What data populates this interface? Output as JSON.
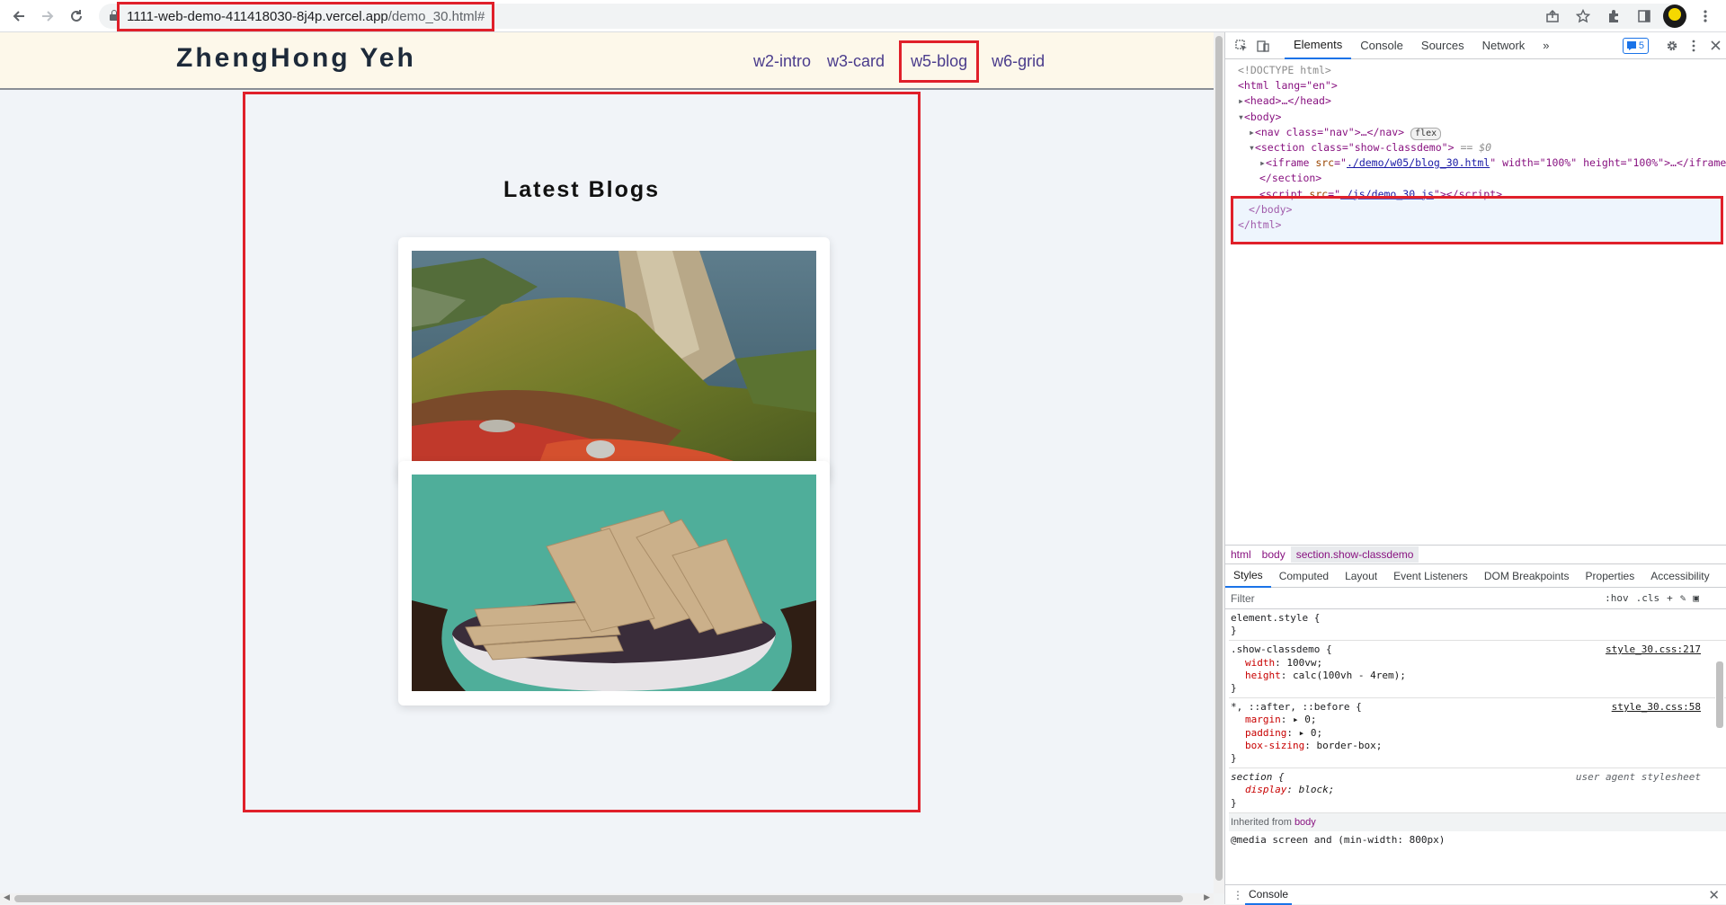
{
  "browser": {
    "url_host": "1111-web-demo-411418030-8j4p.vercel.app",
    "url_path": "/demo_30.html#",
    "back_icon": "arrow-left",
    "forward_icon": "arrow-right",
    "reload_icon": "reload"
  },
  "site": {
    "name": "ZhengHong Yeh",
    "nav": [
      {
        "label": "w2-intro"
      },
      {
        "label": "w3-card"
      },
      {
        "label": "w5-blog"
      },
      {
        "label": "w6-grid"
      }
    ],
    "active_nav": "w5-blog",
    "blog_heading": "Latest Blogs",
    "images": [
      {
        "subject": "autumn mountainside over fjord"
      },
      {
        "subject": "crispbread in a white bowl"
      }
    ]
  },
  "devtools": {
    "tabs": [
      "Elements",
      "Console",
      "Sources",
      "Network"
    ],
    "active_tab": "Elements",
    "more_tabs": "»",
    "issue_count": "5",
    "dom": {
      "doctype": "<!DOCTYPE html>",
      "html_open": "<html lang=\"en\">",
      "head": "<head>…</head>",
      "body_open": "<body>",
      "nav": "<nav class=\"nav\">…</nav>",
      "flex_badge": "flex",
      "section_open": "<section class=\"show-classdemo\">",
      "selected_marker": "== $0",
      "iframe_src": "./demo/w05/blog_30.html",
      "iframe_rest": " width=\"100%\" height=\"100%\">…</iframe>",
      "section_close": "</section>",
      "script_src": "./js/demo_30.js",
      "body_close": "</body>",
      "html_close": "</html>"
    },
    "breadcrumbs": [
      "html",
      "body",
      "section.show-classdemo"
    ],
    "sub_tabs": [
      "Styles",
      "Computed",
      "Layout",
      "Event Listeners",
      "DOM Breakpoints",
      "Properties",
      "Accessibility"
    ],
    "active_sub_tab": "Styles",
    "filter_placeholder": "Filter",
    "filter_buttons": [
      ":hov",
      ".cls",
      "+"
    ],
    "rules": {
      "element_style": "element.style {",
      "r1_selector": ".show-classdemo {",
      "r1_src": "style_30.css:217",
      "r1_props": [
        {
          "name": "width",
          "value": "100vw;"
        },
        {
          "name": "height",
          "value": "calc(100vh - 4rem);"
        }
      ],
      "r2_selector": "*, ::after, ::before {",
      "r2_src": "style_30.css:58",
      "r2_props": [
        {
          "name": "margin",
          "value": "▸ 0;"
        },
        {
          "name": "padding",
          "value": "▸ 0;"
        },
        {
          "name": "box-sizing",
          "value": "border-box;"
        }
      ],
      "r3_selector": "section {",
      "r3_src": "user agent stylesheet",
      "r3_props": [
        {
          "name": "display",
          "value": "block;"
        }
      ],
      "close": "}"
    },
    "inherited_label": "Inherited from",
    "inherited_from": "body",
    "media_query": "@media screen and (min-width: 800px)",
    "console_drawer": "Console"
  }
}
